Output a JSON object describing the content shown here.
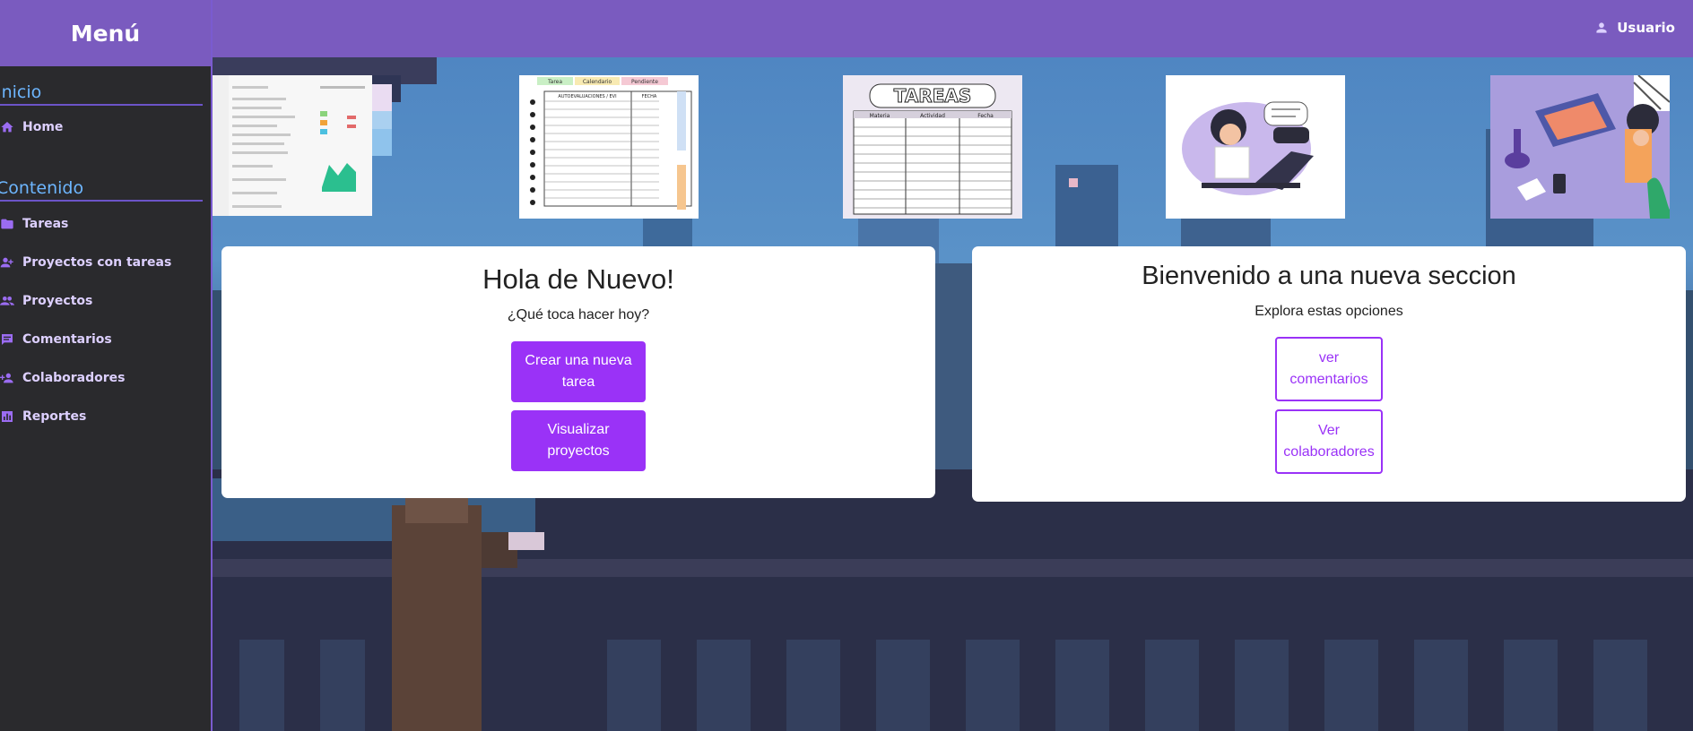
{
  "sidebar": {
    "title": "Menú",
    "sections": [
      {
        "title": "Inicio",
        "items": [
          {
            "label": "Home",
            "icon": "home-icon"
          }
        ]
      },
      {
        "title": "Contenido",
        "items": [
          {
            "label": "Tareas",
            "icon": "folder-icon"
          },
          {
            "label": "Proyectos con tareas",
            "icon": "group-add-icon"
          },
          {
            "label": "Proyectos",
            "icon": "people-icon"
          },
          {
            "label": "Comentarios",
            "icon": "comment-icon"
          },
          {
            "label": "Colaboradores",
            "icon": "person-add-icon"
          },
          {
            "label": "Reportes",
            "icon": "bar-chart-icon"
          }
        ]
      }
    ]
  },
  "header": {
    "user_label": "Usuario",
    "user_icon": "person-icon"
  },
  "thumbnails": {
    "third_title": "TAREAS",
    "third_columns": [
      "Materia",
      "Actividad",
      "Fecha"
    ],
    "second_tabs": [
      "Tarea",
      "Calendario",
      "Pendiente"
    ],
    "second_columns": [
      "AUTOEVALUACIONES / EVI",
      "FECHA"
    ]
  },
  "cards": {
    "left": {
      "title": "Hola de Nuevo!",
      "subtitle": "¿Qué toca hacer hoy?",
      "buttons": [
        "Crear una nueva tarea",
        "Visualizar proyectos"
      ]
    },
    "right": {
      "title": "Bienvenido a una nueva seccion",
      "subtitle": "Explora estas opciones",
      "buttons": [
        "ver comentarios",
        "Ver colaboradores"
      ]
    }
  },
  "colors": {
    "accent": "#9a32f7",
    "header": "#7a5bbf",
    "sidebar": "#2a2a2d",
    "section_title": "#6db6ff"
  }
}
